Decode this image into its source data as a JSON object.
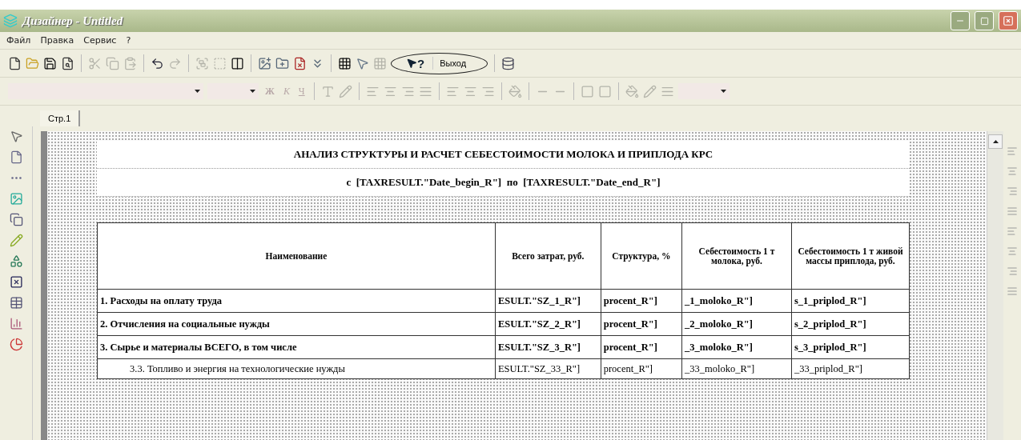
{
  "window": {
    "title": "Дизайнер - Untitled"
  },
  "menu": [
    {
      "label": "Файл"
    },
    {
      "label": "Правка"
    },
    {
      "label": "Сервис"
    },
    {
      "label": "?"
    }
  ],
  "toolbar": {
    "help_label": "?",
    "exit_label": "Выход"
  },
  "format_bar": {
    "bold": "Ж",
    "italic": "К",
    "underline": "Ч"
  },
  "tabs": [
    {
      "label": "Стр.1",
      "selected": true
    }
  ],
  "report": {
    "title": "АНАЛИЗ СТРУКТУРЫ И РАСЧЕТ СЕБЕСТОИМОСТИ МОЛОКА И ПРИПЛОДА КРС",
    "subtitle": "с  [TAXRESULT.\"Date_begin_R\"]  по  [TAXRESULT.\"Date_end_R\"]",
    "columns": [
      "Наименование",
      "Всего затрат, руб.",
      "Структура, %",
      "Себестоимость 1 т молока, руб.",
      "Себестоимость 1 т живой массы приплода, руб."
    ],
    "rows": [
      {
        "kind": "bold",
        "cells": [
          "1. Расходы на оплату труда",
          "ESULT.\"SZ_1_R\"]",
          "procent_R\"]",
          "_1_moloko_R\"]",
          "s_1_priplod_R\"]"
        ]
      },
      {
        "kind": "bold",
        "cells": [
          "2. Отчисления на социальные нужды",
          "ESULT.\"SZ_2_R\"]",
          "procent_R\"]",
          "_2_moloko_R\"]",
          "s_2_priplod_R\"]"
        ]
      },
      {
        "kind": "bold",
        "cells": [
          "3. Сырье и материалы ВСЕГО, в том числе",
          "ESULT.\"SZ_3_R\"]",
          "procent_R\"]",
          "_3_moloko_R\"]",
          "s_3_priplod_R\"]"
        ]
      },
      {
        "kind": "sub",
        "cells": [
          "3.3. Топливо и энергия на технологические нужды",
          "ESULT.\"SZ_33_R\"]",
          "procent_R\"]",
          "_33_moloko_R\"]",
          "_33_priplod_R\"]"
        ]
      }
    ]
  }
}
